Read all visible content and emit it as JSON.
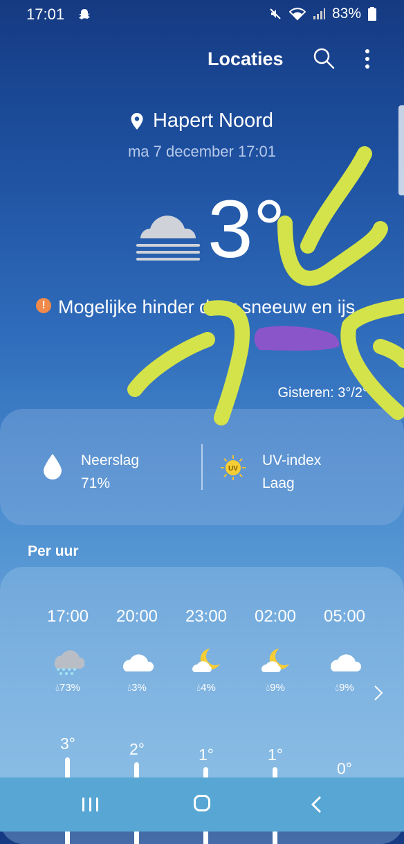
{
  "status_bar": {
    "time": "17:01",
    "battery": "83%"
  },
  "header": {
    "title": "Locaties"
  },
  "location": {
    "name": "Hapert Noord",
    "datetime": "ma 7 december 17:01"
  },
  "current": {
    "temperature": "3°",
    "warning": "Mogelijke hinder door sneeuw en ijs",
    "yesterday": "Gisteren: 3°/2°"
  },
  "details": {
    "precip_label": "Neerslag",
    "precip_value": "71%",
    "uv_label": "UV-index",
    "uv_value": "Laag",
    "uv_badge": "UV"
  },
  "hourly": {
    "heading": "Per uur",
    "items": [
      {
        "time": "17:00",
        "icon": "snow-rain-cloud-icon",
        "precip": "73%",
        "temp": "3°"
      },
      {
        "time": "20:00",
        "icon": "cloud-icon",
        "precip": "3%",
        "temp": "2°"
      },
      {
        "time": "23:00",
        "icon": "moon-cloud-icon",
        "precip": "4%",
        "temp": "1°"
      },
      {
        "time": "02:00",
        "icon": "moon-cloud-icon",
        "precip": "9%",
        "temp": "1°"
      },
      {
        "time": "05:00",
        "icon": "cloud-icon",
        "precip": "9%",
        "temp": "0°"
      }
    ]
  },
  "colors": {
    "warning": "#f08a4b",
    "scribble": "#d4e34a",
    "scribble_fill": "#8a55c8"
  }
}
